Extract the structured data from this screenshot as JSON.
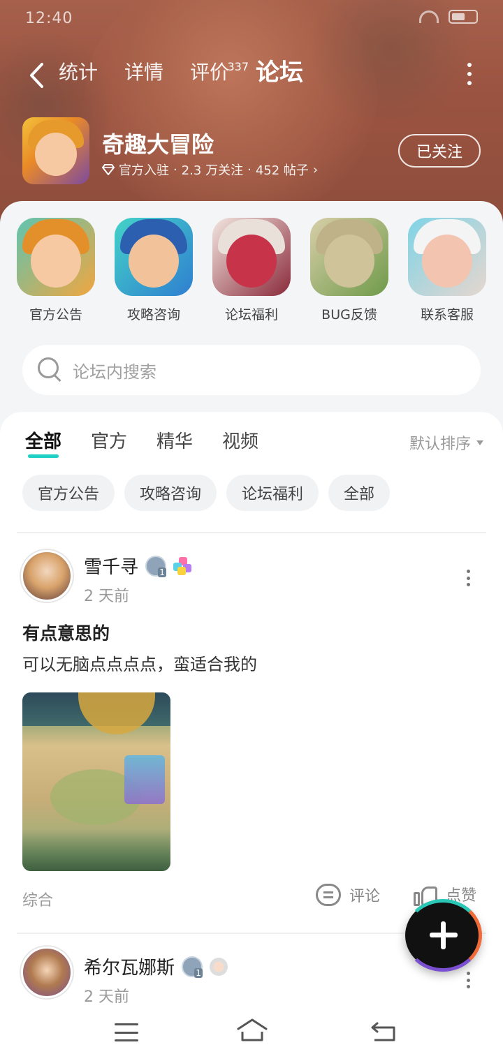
{
  "status_bar": {
    "time": "12:40"
  },
  "nav": {
    "tabs": [
      {
        "label": "统计",
        "active": false
      },
      {
        "label": "详情",
        "active": false
      },
      {
        "label": "评价",
        "active": false,
        "badge": "337"
      },
      {
        "label": "论坛",
        "active": true
      }
    ]
  },
  "game": {
    "name": "奇趣大冒险",
    "official": "官方入驻",
    "followers": "2.3 万关注",
    "posts": "452 帖子",
    "follow_button": "已关注"
  },
  "quick_links": [
    {
      "label": "官方公告",
      "icon": "official-announcement-icon"
    },
    {
      "label": "攻略咨询",
      "icon": "guide-icon"
    },
    {
      "label": "论坛福利",
      "icon": "welfare-icon"
    },
    {
      "label": "BUG反馈",
      "icon": "bug-feedback-icon"
    },
    {
      "label": "联系客服",
      "icon": "customer-service-icon"
    }
  ],
  "search": {
    "placeholder": "论坛内搜索"
  },
  "feed_tabs": [
    {
      "label": "全部",
      "active": true
    },
    {
      "label": "官方"
    },
    {
      "label": "精华"
    },
    {
      "label": "视频"
    }
  ],
  "sort": {
    "label": "默认排序"
  },
  "chips": [
    "官方公告",
    "攻略咨询",
    "论坛福利",
    "全部"
  ],
  "posts": [
    {
      "username": "雪千寻",
      "time": "2 天前",
      "title": "有点意思的",
      "body": "可以无脑点点点点，蛮适合我的",
      "tag": "综合",
      "comment_label": "评论",
      "like_label": "点赞"
    },
    {
      "username": "希尔瓦娜斯",
      "time": "2 天前"
    }
  ],
  "colors": {
    "accent": "#1fd1c4",
    "header": "#a85a47"
  }
}
